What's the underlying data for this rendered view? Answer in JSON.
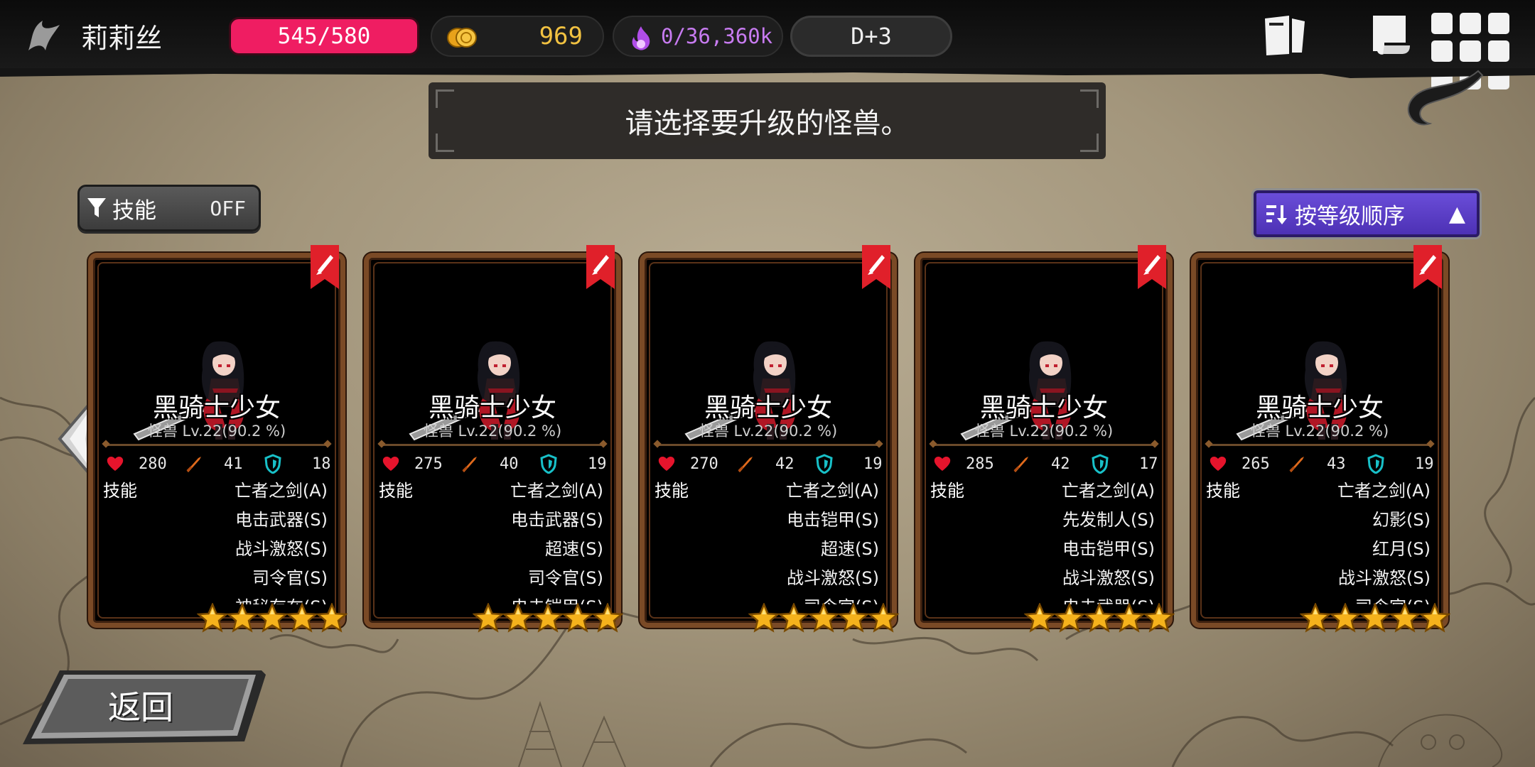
{
  "player": {
    "name": "莉莉丝"
  },
  "resources": {
    "hp": "545/580",
    "gold": "969",
    "soul": "0/36,360k",
    "day": "D+3"
  },
  "prompt": "请选择要升级的怪兽。",
  "filter": {
    "label": "技能",
    "state": "OFF"
  },
  "sort": {
    "label": "按等级顺序",
    "arrow": "▲"
  },
  "skills_heading": "技能",
  "back_label": "返回",
  "colors": {
    "hp": "#ef1d62",
    "gold": "#f2c241",
    "soul": "#c77bf0",
    "sort": "#5a3cc8",
    "card_border": "#7a4a26"
  },
  "cards": [
    {
      "name": "黑骑士少女",
      "level": "怪兽 Lv.22(90.2 %)",
      "hp": "280",
      "atk": "41",
      "def": "18",
      "skills": [
        "亡者之剑(A)",
        "电击武器(S)",
        "战斗激怒(S)",
        "司令官(S)",
        "神秘存在(S)"
      ],
      "stars": 5
    },
    {
      "name": "黑骑士少女",
      "level": "怪兽 Lv.22(90.2 %)",
      "hp": "275",
      "atk": "40",
      "def": "19",
      "skills": [
        "亡者之剑(A)",
        "电击武器(S)",
        "超速(S)",
        "司令官(S)",
        "电击铠甲(S)"
      ],
      "stars": 5
    },
    {
      "name": "黑骑士少女",
      "level": "怪兽 Lv.22(90.2 %)",
      "hp": "270",
      "atk": "42",
      "def": "19",
      "skills": [
        "亡者之剑(A)",
        "电击铠甲(S)",
        "超速(S)",
        "战斗激怒(S)",
        "司令官(S)"
      ],
      "stars": 5
    },
    {
      "name": "黑骑士少女",
      "level": "怪兽 Lv.22(90.2 %)",
      "hp": "285",
      "atk": "42",
      "def": "17",
      "skills": [
        "亡者之剑(A)",
        "先发制人(S)",
        "电击铠甲(S)",
        "战斗激怒(S)",
        "电击武器(S)"
      ],
      "stars": 5
    },
    {
      "name": "黑骑士少女",
      "level": "怪兽 Lv.22(90.2 %)",
      "hp": "265",
      "atk": "43",
      "def": "19",
      "skills": [
        "亡者之剑(A)",
        "幻影(S)",
        "红月(S)",
        "战斗激怒(S)",
        "司令官(S)"
      ],
      "stars": 5
    }
  ]
}
